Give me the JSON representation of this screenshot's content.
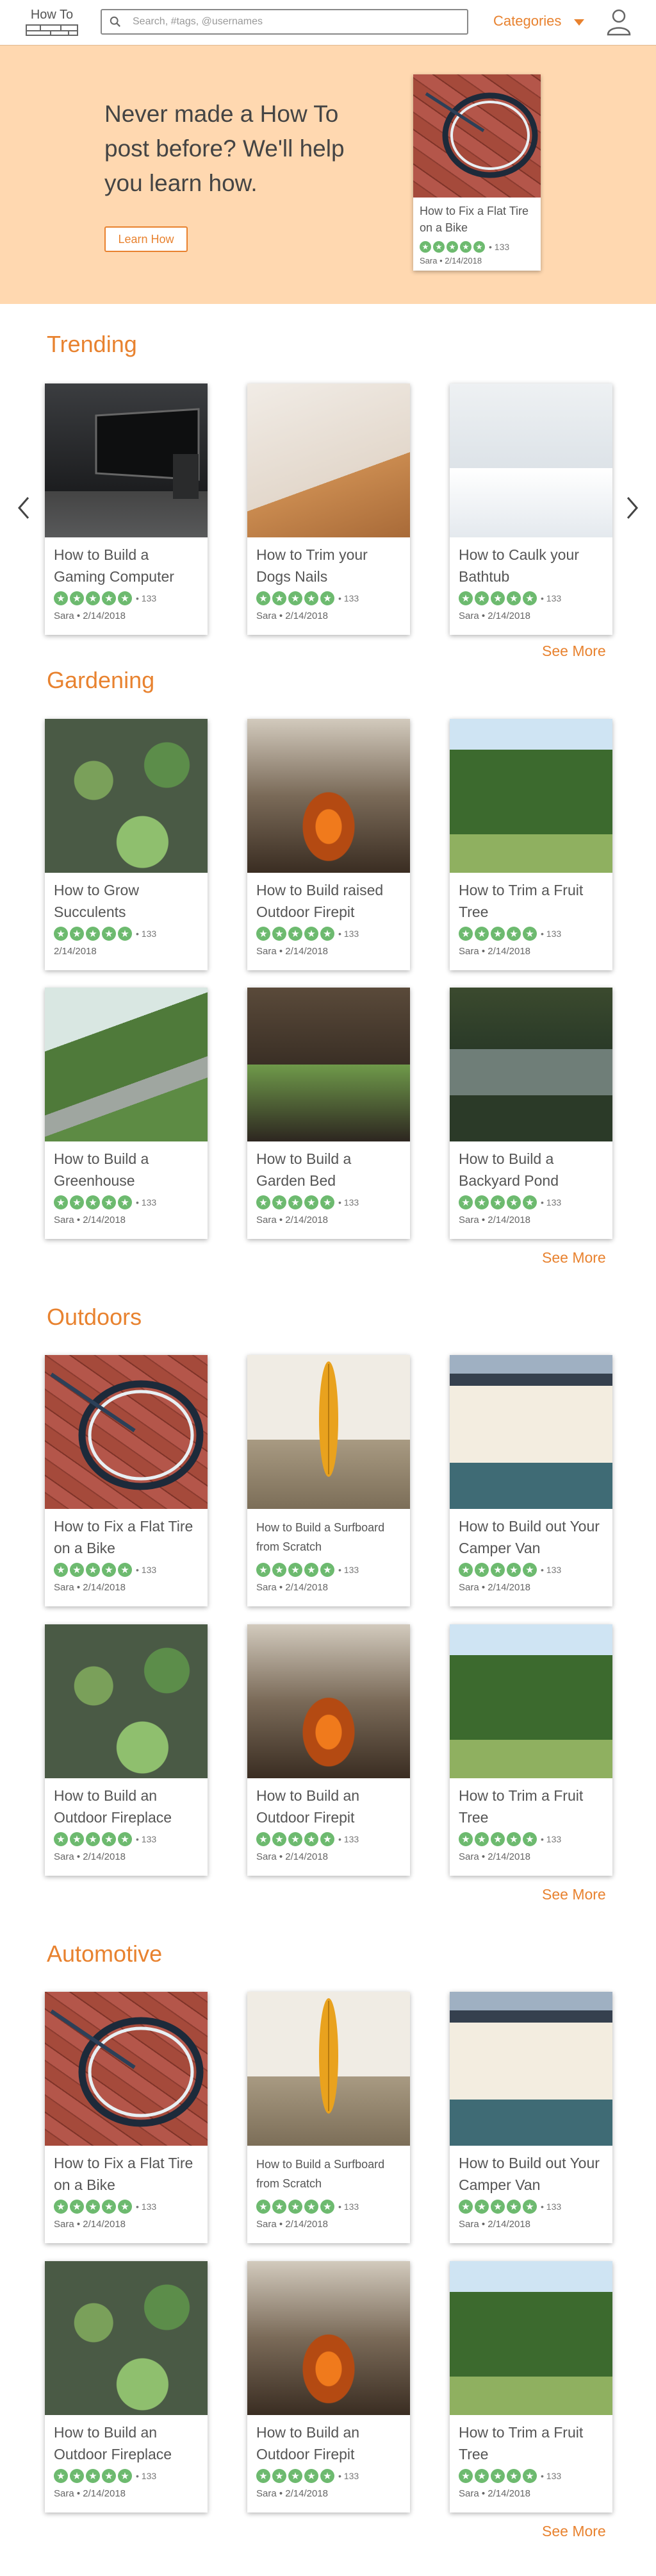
{
  "header": {
    "logo_text": "How To",
    "search_placeholder": "Search, #tags, @usernames",
    "categories_label": "Categories"
  },
  "hero": {
    "text": "Never made a How To post before? We'll help you learn how.",
    "button_label": "Learn How",
    "card": {
      "title": "How to Fix a Flat Tire on a Bike",
      "count": "133",
      "author": "Sara",
      "date": "2/14/2018"
    }
  },
  "sections": [
    {
      "title": "Trending",
      "see_more": "See More",
      "cards": [
        {
          "title": "How to Build a Gaming Computer",
          "count": "133",
          "meta": "Sara • 2/14/2018"
        },
        {
          "title": "How to Trim your Dogs Nails",
          "count": "133",
          "meta": "Sara • 2/14/2018"
        },
        {
          "title": "How to Caulk your Bathtub",
          "count": "133",
          "meta": "Sara • 2/14/2018"
        }
      ]
    },
    {
      "title": "Gardening",
      "see_more": "See More",
      "cards": [
        {
          "title": "How to Grow Succulents",
          "count": "133",
          "meta": "2/14/2018"
        },
        {
          "title": "How to Build raised Outdoor Firepit",
          "count": "133",
          "meta": "Sara • 2/14/2018"
        },
        {
          "title": "How to Trim a Fruit Tree",
          "count": "133",
          "meta": "Sara • 2/14/2018"
        },
        {
          "title": "How to Build a Greenhouse",
          "count": "133",
          "meta": "Sara • 2/14/2018"
        },
        {
          "title": "How to Build a Garden Bed",
          "count": "133",
          "meta": "Sara • 2/14/2018"
        },
        {
          "title": "How to Build a Backyard Pond",
          "count": "133",
          "meta": "Sara • 2/14/2018"
        }
      ]
    },
    {
      "title": "Outdoors",
      "see_more": "See More",
      "cards": [
        {
          "title": "How to Fix a Flat Tire on a Bike",
          "count": "133",
          "meta": "Sara • 2/14/2018"
        },
        {
          "title": "How to Build a Surfboard from Scratch",
          "count": "133",
          "meta": "Sara • 2/14/2018"
        },
        {
          "title": "How to Build out Your Camper Van",
          "count": "133",
          "meta": "Sara • 2/14/2018"
        },
        {
          "title": "How to Build an Outdoor Fireplace",
          "count": "133",
          "meta": "Sara • 2/14/2018"
        },
        {
          "title": "How to Build an Outdoor Firepit",
          "count": "133",
          "meta": "Sara • 2/14/2018"
        },
        {
          "title": "How to Trim a Fruit Tree",
          "count": "133",
          "meta": "Sara • 2/14/2018"
        }
      ]
    },
    {
      "title": "Automotive",
      "see_more": "See More",
      "cards": [
        {
          "title": "How to Fix a Flat Tire on a Bike",
          "count": "133",
          "meta": "Sara • 2/14/2018"
        },
        {
          "title": "How to Build a Surfboard from Scratch",
          "count": "133",
          "meta": "Sara • 2/14/2018"
        },
        {
          "title": "How to Build out Your Camper Van",
          "count": "133",
          "meta": "Sara • 2/14/2018"
        },
        {
          "title": "How to Build an Outdoor Fireplace",
          "count": "133",
          "meta": "Sara • 2/14/2018"
        },
        {
          "title": "How to Build an Outdoor Firepit",
          "count": "133",
          "meta": "Sara • 2/14/2018"
        },
        {
          "title": "How to Trim a Fruit Tree",
          "count": "133",
          "meta": "Sara • 2/14/2018"
        }
      ]
    }
  ],
  "colors": {
    "accent": "#e8822f",
    "hero_bg": "#ffd8b0",
    "star": "#6dba6f"
  }
}
